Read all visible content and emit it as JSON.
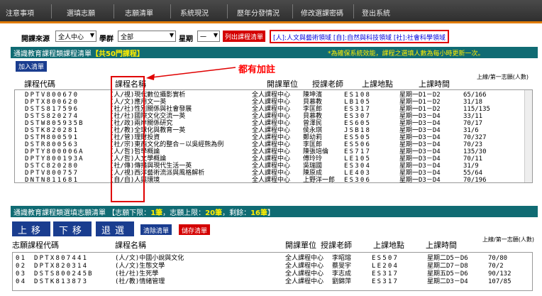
{
  "nav": {
    "items": [
      "注意事項",
      "選填志願",
      "志願清單",
      "系統現況",
      "歷年分發情況",
      "修改選課密碼",
      "登出系統"
    ]
  },
  "filters": {
    "source_label": "開課來源",
    "source_value": "全人中心",
    "group_label": "學群",
    "group_value": "全部",
    "week_label": "星期",
    "week_value": "一",
    "list_codes_button": "列出課程清單",
    "legend": "[人]:人文與藝術領域 [自]:自然與科技領域 [社]:社會科學領域"
  },
  "panel1": {
    "title_prefix": "通識教育課程類課程清單",
    "title_count": "【共50門課程】",
    "note": "*為確保系統效能，課程之選填人數為每小時更新一次。",
    "add_button": "加入清單",
    "annotation": "都有加註",
    "headers": {
      "code": "課程代碼",
      "name": "課程名稱",
      "unit": "開課單位",
      "teacher": "授課老師",
      "location": "上課地點",
      "time": "上課時間",
      "count": "上線/第一志願(人數)"
    },
    "rows": [
      {
        "code": "DPTV800670",
        "name": "(人/視)現代數位攝影實析",
        "unit": "全人課程中心",
        "teacher": "陳坤濱",
        "location": "ES108",
        "time": "星期一D1－D2",
        "count": "65/166"
      },
      {
        "code": "DPTX800620",
        "name": "(人/文)應用文一英",
        "unit": "全人課程中心",
        "teacher": "貝慕教",
        "location": "LB105",
        "time": "星期一D1－D2",
        "count": "31/18"
      },
      {
        "code": "DSTS817596",
        "name": "(社/社)性別關係與社會發展",
        "unit": "全人課程中心",
        "teacher": "李匡郎",
        "location": "ES317",
        "time": "星期一D1－D2",
        "count": "115/135"
      },
      {
        "code": "DSTS820274",
        "name": "(社/社)國際文化交流一英",
        "unit": "全人課程中心",
        "teacher": "貝慕教",
        "location": "ES307",
        "time": "星期一D3－D4",
        "count": "33/11"
      },
      {
        "code": "DSTW805935B",
        "name": "(社/政)兩岸關係研究",
        "unit": "全人課程中心",
        "teacher": "曾澤民",
        "location": "ES605",
        "time": "星期一D3－D4",
        "count": "70/17"
      },
      {
        "code": "DSTK820281",
        "name": "(社/教)全球化與教育一英",
        "unit": "全人課程中心",
        "teacher": "侯永琪",
        "location": "JSB18",
        "time": "星期一D3－D4",
        "count": "31/6"
      },
      {
        "code": "DSTM800591",
        "name": "(社/管)理財投資",
        "unit": "全人課程中心",
        "teacher": "鄭幼莉",
        "location": "ES505",
        "time": "星期一D3－D4",
        "count": "70/327"
      },
      {
        "code": "DSTR800563",
        "name": "(社/宗)東西文化的整合－以吳經熊為例",
        "unit": "全人課程中心",
        "teacher": "李匡郎",
        "location": "ES506",
        "time": "星期一D3－D4",
        "count": "70/23"
      },
      {
        "code": "DPTY800006A",
        "name": "(人/哲)哲學概論",
        "unit": "全人課程中心",
        "teacher": "陳張培倫",
        "location": "ES717",
        "time": "星期一D3－D4",
        "count": "135/30"
      },
      {
        "code": "DPTY800193A",
        "name": "(人/哲)人文學概論",
        "unit": "全人課程中心",
        "teacher": "傅玲玲",
        "location": "LE105",
        "time": "星期一D3－D4",
        "count": "70/11"
      },
      {
        "code": "DSTC820280",
        "name": "(社/傳)傳播與現代生活一英",
        "unit": "全人課程中心",
        "teacher": "吳瑞國",
        "location": "ES304",
        "time": "星期一D3－D4",
        "count": "31/9"
      },
      {
        "code": "DPTV800757",
        "name": "(人/視)西洋藝術流派與風格解析",
        "unit": "全人課程中心",
        "teacher": "陳原成",
        "location": "LE403",
        "time": "星期一D3－D4",
        "count": "55/64"
      },
      {
        "code": "DNTN811681",
        "name": "(自/自)人與環境",
        "unit": "全人課程中心",
        "teacher": "上野洋一郎",
        "location": "ES306",
        "time": "星期一D3－D4",
        "count": "70/196"
      }
    ]
  },
  "panel2": {
    "title_prefix": "通識教育課程類選填志願清單",
    "title_lower_label": "【志願下限：",
    "title_lower_value": "1筆",
    "title_upper_label": "，志願上限：",
    "title_upper_value": "20筆",
    "title_remain_label": "，剩餘：",
    "title_remain_value": "16筆",
    "title_end": "】",
    "buttons": {
      "up": "上移",
      "down": "下移",
      "back": "退選",
      "clear": "清除清單",
      "save": "儲存清單"
    },
    "headers": {
      "code": "志願課程代碼",
      "name": "課程名稱",
      "unit": "開課單位",
      "teacher": "授課老師",
      "location": "上課地點",
      "time": "上課時間",
      "count": "上線/第一志願(人數)"
    },
    "rows": [
      {
        "no": "01",
        "code": "DPTX807441",
        "name": "(人/文)中國小說與文化",
        "unit": "全人課程中心",
        "teacher": "李昭瑢",
        "location": "ES507",
        "time": "星期二D5－D6",
        "count": "70/80"
      },
      {
        "no": "02",
        "code": "DPTX820314",
        "name": "(人/文)生態文學",
        "unit": "全人課程中心",
        "teacher": "蔡旻宇",
        "location": "LE204",
        "time": "星期二D7－D8",
        "count": "70/2"
      },
      {
        "no": "03",
        "code": "DSTS800245B",
        "name": "(社/社)生死學",
        "unit": "全人課程中心",
        "teacher": "李志成",
        "location": "ES317",
        "time": "星期五D5－D6",
        "count": "90/132"
      },
      {
        "no": "04",
        "code": "DSTK813873",
        "name": "(社/教)情緒管理",
        "unit": "全人課程中心",
        "teacher": "劉錦萍",
        "location": "ES317",
        "time": "星期二D3－D4",
        "count": "107/85"
      }
    ]
  }
}
